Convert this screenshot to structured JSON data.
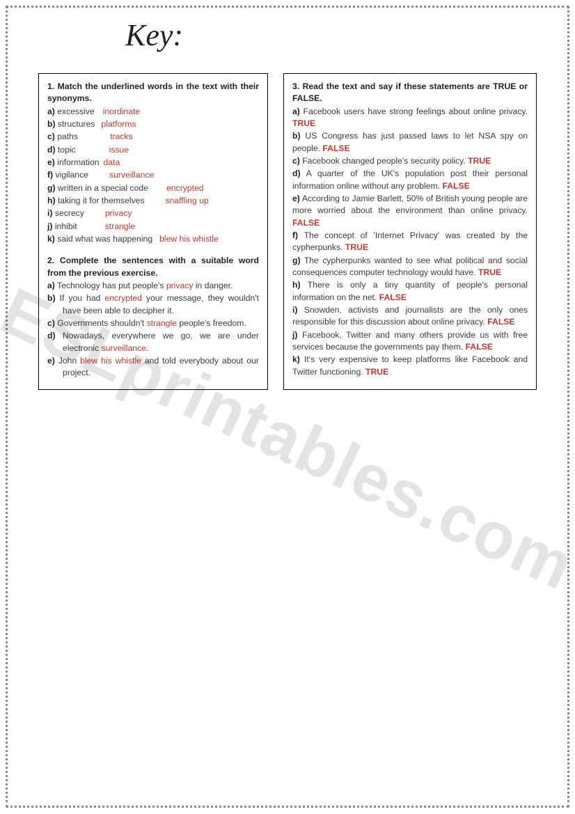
{
  "title": "Key:",
  "watermark": "ESLprintables.com",
  "left": {
    "q1": {
      "heading": "1. Match the underlined words in the text with their synonyms.",
      "items": [
        {
          "l": "a)",
          "w": "excessive",
          "gap": 12,
          "a": "inordinate"
        },
        {
          "l": "b)",
          "w": "structures",
          "gap": 9,
          "a": "platforms"
        },
        {
          "l": "c)",
          "w": "paths",
          "gap": 46,
          "a": "tracks"
        },
        {
          "l": "d)",
          "w": "topic",
          "gap": 48,
          "a": "issue"
        },
        {
          "l": "e)",
          "w": "information",
          "gap": 6,
          "a": "data"
        },
        {
          "l": "f)",
          "w": "vigilance",
          "gap": 30,
          "a": "surveillance"
        },
        {
          "l": "g)",
          "w": "written in a special code",
          "gap": 26,
          "a": "encrypted"
        },
        {
          "l": "h)",
          "w": "taking it for themselves",
          "gap": 30,
          "a": "snaffling up"
        },
        {
          "l": "i)",
          "w": "secrecy",
          "gap": 30,
          "a": "privacy"
        },
        {
          "l": "j)",
          "w": "inhibit",
          "gap": 40,
          "a": "strangle"
        },
        {
          "l": "k)",
          "w": "said what was happening",
          "gap": 10,
          "a": "blew his whistle"
        }
      ]
    },
    "q2": {
      "heading": "2. Complete the sentences with a suitable word from the previous exercise.",
      "items": [
        {
          "l": "a)",
          "pre": "Technology has put people's ",
          "a": "privacy",
          "post": " in danger."
        },
        {
          "l": "b)",
          "pre": "If you had ",
          "a": "encrypted",
          "post": " your message, they wouldn't have been able to decipher it."
        },
        {
          "l": "c)",
          "pre": "Governments shouldn't ",
          "a": "strangle",
          "post": " people's freedom."
        },
        {
          "l": "d)",
          "pre": "Nowadays, everywhere we go, we are under electronic ",
          "a": "surveillance",
          "post": "."
        },
        {
          "l": "e)",
          "pre": "John ",
          "a": "blew his whistle",
          "post": " and told everybody about our project."
        }
      ]
    }
  },
  "right": {
    "q3": {
      "heading": "3. Read the text and say if these statements are TRUE or FALSE.",
      "items": [
        {
          "l": "a)",
          "t": "Facebook users have strong feelings about online privacy.",
          "a": "TRUE"
        },
        {
          "l": "b)",
          "t": "US Congress has just passed laws to let NSA spy on people.",
          "a": "FALSE"
        },
        {
          "l": "c)",
          "t": "Facebook changed people's security policy.",
          "a": "TRUE"
        },
        {
          "l": "d)",
          "t": "A quarter of the UK's population post their personal information online without any problem.",
          "a": "FALSE"
        },
        {
          "l": "e)",
          "t": "According to Jamie Barlett, 50% of British young people are more worried about the environment than online privacy.",
          "a": "FALSE"
        },
        {
          "l": "f)",
          "t": "The concept of 'Internet Privacy' was created by the cypherpunks.",
          "a": "TRUE"
        },
        {
          "l": "g)",
          "t": "The cypherpunks wanted to see what political and social consequences computer technology would have.",
          "a": "TRUE"
        },
        {
          "l": "h)",
          "t": "There is only a tiny quantity of people's personal information on the net.",
          "a": "FALSE"
        },
        {
          "l": "i)",
          "t": "Snowden, activists and journalists are the only ones responsible for this discussion about online privacy.",
          "a": "FALSE"
        },
        {
          "l": "j)",
          "t": "Facebook, Twitter and many others provide us with free services because the governments pay them.",
          "a": "FALSE"
        },
        {
          "l": "k)",
          "t": "It's very expensive to keep platforms like Facebook and Twitter functioning.",
          "a": "TRUE"
        }
      ]
    }
  }
}
